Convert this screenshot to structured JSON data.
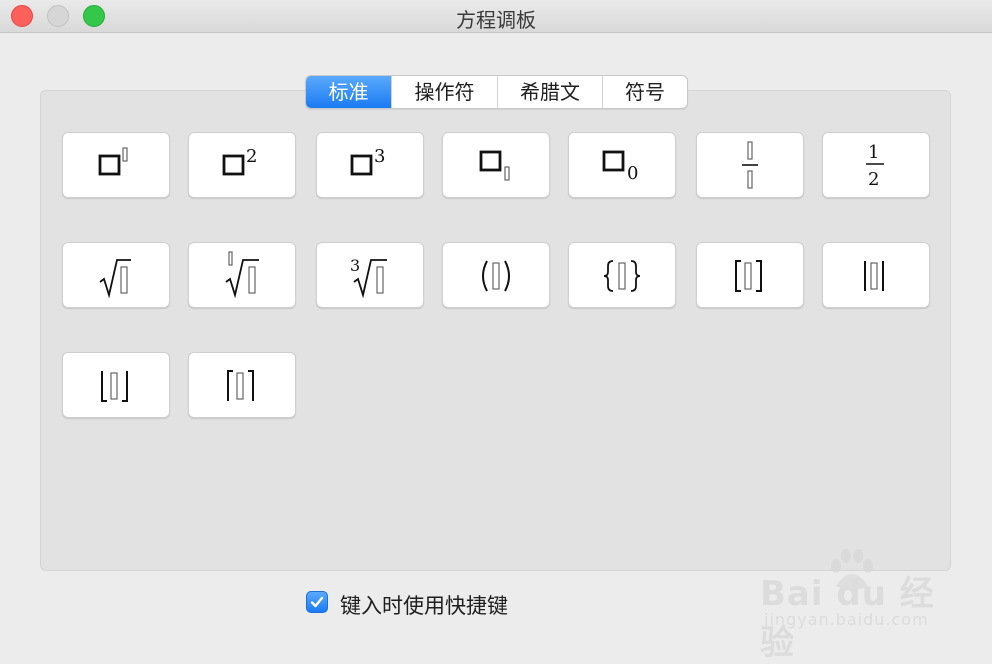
{
  "window": {
    "title": "方程调板"
  },
  "tabs": [
    {
      "label": "标准",
      "active": true
    },
    {
      "label": "操作符",
      "active": false
    },
    {
      "label": "希腊文",
      "active": false
    },
    {
      "label": "符号",
      "active": false
    }
  ],
  "buttons": [
    {
      "name": "superscript-template-button",
      "symbol": "superscript-slot"
    },
    {
      "name": "square-template-button",
      "symbol": "power-2",
      "text": "2"
    },
    {
      "name": "cube-template-button",
      "symbol": "power-3",
      "text": "3"
    },
    {
      "name": "subscript-template-button",
      "symbol": "subscript-slot"
    },
    {
      "name": "subscript-zero-template-button",
      "symbol": "subscript-0",
      "text": "0"
    },
    {
      "name": "fraction-template-button",
      "symbol": "fraction-slots"
    },
    {
      "name": "one-half-template-button",
      "symbol": "fraction-one-half",
      "numerator": "1",
      "denominator": "2"
    },
    {
      "name": "square-root-template-button",
      "symbol": "square-root"
    },
    {
      "name": "nth-root-template-button",
      "symbol": "nth-root"
    },
    {
      "name": "cube-root-template-button",
      "symbol": "cube-root",
      "text": "3"
    },
    {
      "name": "parentheses-template-button",
      "symbol": "parentheses"
    },
    {
      "name": "braces-template-button",
      "symbol": "braces"
    },
    {
      "name": "brackets-template-button",
      "symbol": "brackets"
    },
    {
      "name": "absolute-value-template-button",
      "symbol": "vertical-bars"
    },
    {
      "name": "floor-template-button",
      "symbol": "floor"
    },
    {
      "name": "ceiling-template-button",
      "symbol": "ceiling"
    }
  ],
  "shortcut_checkbox": {
    "checked": true,
    "label": "键入时使用快捷键"
  },
  "watermark": {
    "brand": "Bai du 经验",
    "site": "jingyan.baidu.com"
  },
  "colors": {
    "accent": "#1b7bf3",
    "close": "#fc605b",
    "maximize": "#34c749"
  }
}
